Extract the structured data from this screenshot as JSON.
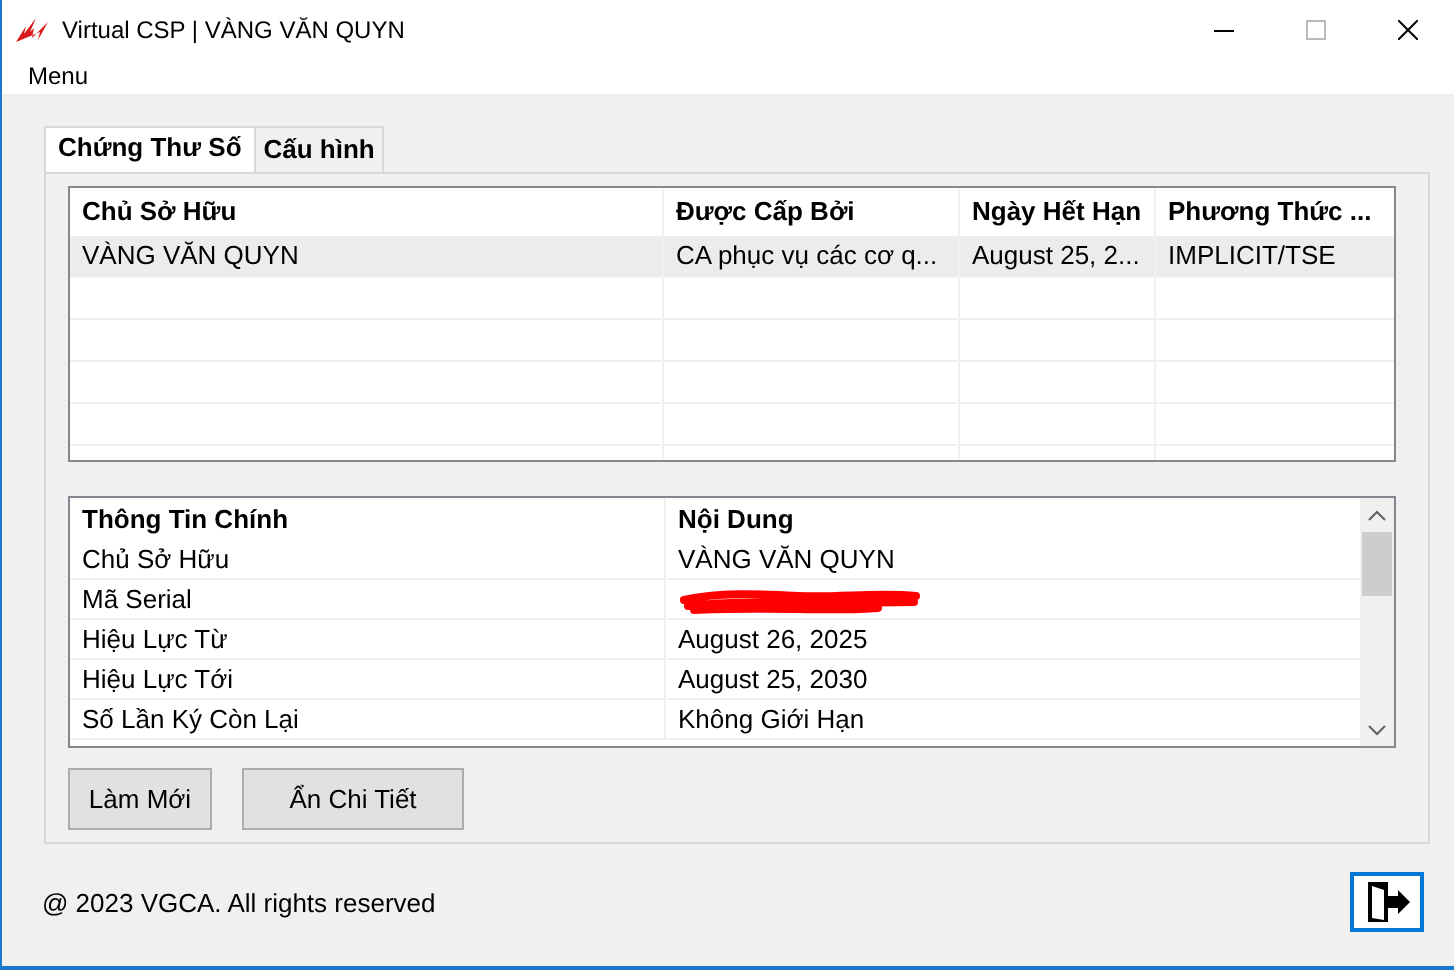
{
  "window": {
    "title": "Virtual CSP | VÀNG VĂN QUYN"
  },
  "menu": [
    "Menu"
  ],
  "tabs": [
    {
      "label": "Chứng Thư Số",
      "selected": true
    },
    {
      "label": "Cấu hình",
      "selected": false
    }
  ],
  "certificates": {
    "columns": [
      "Chủ Sở Hữu",
      "Được Cấp Bởi",
      "Ngày Hết Hạn",
      "Phương Thức ..."
    ],
    "rows": [
      {
        "cells": [
          "VÀNG VĂN QUYN",
          "CA phục vụ các cơ q...",
          "August 25, 2...",
          "IMPLICIT/TSE"
        ],
        "selected": true
      }
    ]
  },
  "details": {
    "columns": [
      "Thông Tin Chính",
      "Nội Dung"
    ],
    "rows": [
      {
        "cells": [
          "Chủ Sở Hữu",
          "VÀNG VĂN QUYN"
        ],
        "redacted": false
      },
      {
        "cells": [
          "Mã Serial"
        ],
        "redacted": true
      },
      {
        "cells": [
          "Hiệu Lực Từ",
          "August 26, 2025"
        ],
        "redacted": false
      },
      {
        "cells": [
          "Hiệu Lực Tới",
          "August 25, 2030"
        ],
        "redacted": false
      },
      {
        "cells": [
          "Số Lần Ký Còn Lại",
          "Không Giới Hạn"
        ],
        "redacted": false
      }
    ]
  },
  "buttons": [
    "Làm Mới",
    "Ẩn Chi Tiết"
  ],
  "footer": "@ 2023 VGCA. All rights reserved"
}
